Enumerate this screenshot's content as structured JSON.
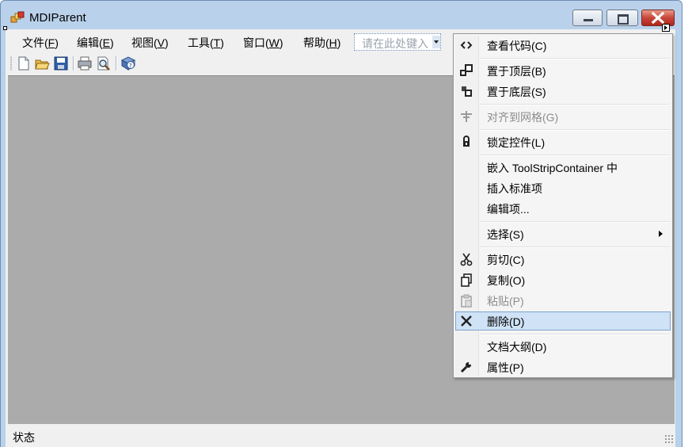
{
  "window": {
    "title": "MDIParent"
  },
  "menubar": {
    "items": [
      {
        "text": "文件(",
        "key": "F",
        "end": ")"
      },
      {
        "text": "编辑(",
        "key": "E",
        "end": ")"
      },
      {
        "text": "视图(",
        "key": "V",
        "end": ")"
      },
      {
        "text": "工具(",
        "key": "T",
        "end": ")"
      },
      {
        "text": "窗口(",
        "key": "W",
        "end": ")"
      },
      {
        "text": "帮助(",
        "key": "H",
        "end": ")"
      }
    ],
    "type_here_placeholder": "请在此处键入"
  },
  "toolbar": {
    "icons": [
      "new-document-icon",
      "open-folder-icon",
      "save-icon",
      "print-icon",
      "print-preview-icon",
      "help-icon"
    ]
  },
  "statusbar": {
    "text": "状态"
  },
  "context_menu": {
    "items": [
      {
        "label": "查看代码(C)",
        "icon": "view-code-icon",
        "disabled": false
      },
      {
        "label": "置于顶层(B)",
        "icon": "bring-to-front-icon",
        "disabled": false
      },
      {
        "label": "置于底层(S)",
        "icon": "send-to-back-icon",
        "disabled": false
      },
      {
        "label": "对齐到网格(G)",
        "icon": "align-to-grid-icon",
        "disabled": true
      },
      {
        "label": "锁定控件(L)",
        "icon": "lock-icon",
        "disabled": false
      },
      {
        "label": "嵌入 ToolStripContainer 中",
        "icon": "",
        "disabled": false
      },
      {
        "label": "插入标准项",
        "icon": "",
        "disabled": false
      },
      {
        "label": "编辑项...",
        "icon": "",
        "disabled": false
      },
      {
        "label": "选择(S)",
        "icon": "",
        "disabled": false,
        "submenu": true
      },
      {
        "label": "剪切(C)",
        "icon": "scissors-icon",
        "disabled": false
      },
      {
        "label": "复制(O)",
        "icon": "copy-icon",
        "disabled": false
      },
      {
        "label": "粘贴(P)",
        "icon": "paste-icon",
        "disabled": true
      },
      {
        "label": "删除(D)",
        "icon": "delete-icon",
        "disabled": false,
        "highlighted": true
      },
      {
        "label": "文档大纲(D)",
        "icon": "",
        "disabled": false
      },
      {
        "label": "属性(P)",
        "icon": "wrench-icon",
        "disabled": false
      }
    ]
  },
  "colors": {
    "frame": "#b9d1ea",
    "mdi_background": "#ababab",
    "close_button": "#c7463a",
    "menu_highlight": "#cfe2f6"
  }
}
